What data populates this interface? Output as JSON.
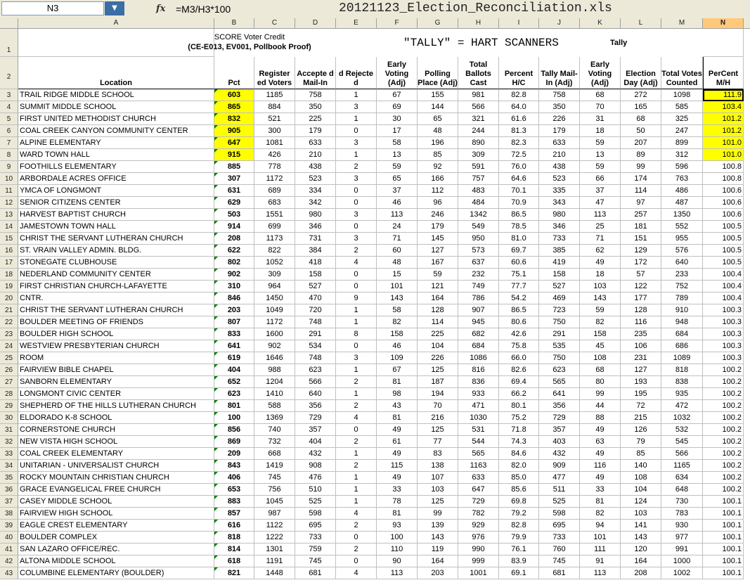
{
  "formula_bar": {
    "name_box": "N3",
    "dropdown_icon": "chevron-down-icon",
    "fx_label": "fx",
    "formula": "=M3/H3*100",
    "file_title": "20121123_Election_Reconciliation.xls"
  },
  "columns": [
    "A",
    "B",
    "C",
    "D",
    "E",
    "F",
    "G",
    "H",
    "I",
    "J",
    "K",
    "L",
    "M",
    "N"
  ],
  "title_row": {
    "row_number": "1",
    "score_line1": "SCORE Voter Credit",
    "score_line2": "(CE-E013, EV001, Pollbook Proof)",
    "tally_label": "\"TALLY\" = HART SCANNERS",
    "tally_small": "Tally"
  },
  "header_row": {
    "row_number": "2",
    "location": "Location",
    "pct": "Pct",
    "registered_voters": "Register ed Voters",
    "accepted_mail_in": "Accepte d Mail-In",
    "rejected": "d Rejecte d",
    "early_voting_adj": "Early Voting (Adj)",
    "polling_place_adj": "Polling Place (Adj)",
    "total_ballots_cast": "Total Ballots Cast",
    "percent_hc": "Percent H/C",
    "tally_mail_in_adj": "Tally Mail-In (Adj)",
    "early_voting_adj2": "Early Voting (Adj)",
    "election_day_adj": "Election Day (Adj)",
    "total_votes_counted": "Total Votes Counted",
    "percent_mh": "PerCent M/H"
  },
  "rows": [
    {
      "n": "3",
      "loc": "TRAIL RIDGE MIDDLE SCHOOL",
      "pct": "603",
      "c": "1185",
      "d": "758",
      "e": "1",
      "f": "67",
      "g": "155",
      "h": "981",
      "i": "82.8",
      "j": "758",
      "k": "68",
      "l": "272",
      "m": "1098",
      "nn": "111.9",
      "hl": true
    },
    {
      "n": "4",
      "loc": "SUMMIT MIDDLE SCHOOL",
      "pct": "865",
      "c": "884",
      "d": "350",
      "e": "3",
      "f": "69",
      "g": "144",
      "h": "566",
      "i": "64.0",
      "j": "350",
      "k": "70",
      "l": "165",
      "m": "585",
      "nn": "103.4",
      "hl": true
    },
    {
      "n": "5",
      "loc": "FIRST UNITED METHODIST CHURCH",
      "pct": "832",
      "c": "521",
      "d": "225",
      "e": "1",
      "f": "30",
      "g": "65",
      "h": "321",
      "i": "61.6",
      "j": "226",
      "k": "31",
      "l": "68",
      "m": "325",
      "nn": "101.2",
      "hl": true
    },
    {
      "n": "6",
      "loc": "COAL CREEK CANYON COMMUNITY CENTER",
      "pct": "905",
      "c": "300",
      "d": "179",
      "e": "0",
      "f": "17",
      "g": "48",
      "h": "244",
      "i": "81.3",
      "j": "179",
      "k": "18",
      "l": "50",
      "m": "247",
      "nn": "101.2",
      "hl": true
    },
    {
      "n": "7",
      "loc": "ALPINE ELEMENTARY",
      "pct": "647",
      "c": "1081",
      "d": "633",
      "e": "3",
      "f": "58",
      "g": "196",
      "h": "890",
      "i": "82.3",
      "j": "633",
      "k": "59",
      "l": "207",
      "m": "899",
      "nn": "101.0",
      "hl": true
    },
    {
      "n": "8",
      "loc": "WARD TOWN HALL",
      "pct": "915",
      "c": "426",
      "d": "210",
      "e": "1",
      "f": "13",
      "g": "85",
      "h": "309",
      "i": "72.5",
      "j": "210",
      "k": "13",
      "l": "89",
      "m": "312",
      "nn": "101.0",
      "hl": true
    },
    {
      "n": "9",
      "loc": "FOOTHILLS ELEMENTARY",
      "pct": "885",
      "c": "778",
      "d": "438",
      "e": "2",
      "f": "59",
      "g": "92",
      "h": "591",
      "i": "76.0",
      "j": "438",
      "k": "59",
      "l": "99",
      "m": "596",
      "nn": "100.8",
      "hl": false
    },
    {
      "n": "10",
      "loc": "ARBORDALE ACRES OFFICE",
      "pct": "307",
      "c": "1172",
      "d": "523",
      "e": "3",
      "f": "65",
      "g": "166",
      "h": "757",
      "i": "64.6",
      "j": "523",
      "k": "66",
      "l": "174",
      "m": "763",
      "nn": "100.8",
      "hl": false
    },
    {
      "n": "11",
      "loc": "YMCA OF LONGMONT",
      "pct": "631",
      "c": "689",
      "d": "334",
      "e": "0",
      "f": "37",
      "g": "112",
      "h": "483",
      "i": "70.1",
      "j": "335",
      "k": "37",
      "l": "114",
      "m": "486",
      "nn": "100.6",
      "hl": false
    },
    {
      "n": "12",
      "loc": "SENIOR CITIZENS CENTER",
      "pct": "629",
      "c": "683",
      "d": "342",
      "e": "0",
      "f": "46",
      "g": "96",
      "h": "484",
      "i": "70.9",
      "j": "343",
      "k": "47",
      "l": "97",
      "m": "487",
      "nn": "100.6",
      "hl": false
    },
    {
      "n": "13",
      "loc": "HARVEST BAPTIST CHURCH",
      "pct": "503",
      "c": "1551",
      "d": "980",
      "e": "3",
      "f": "113",
      "g": "246",
      "h": "1342",
      "i": "86.5",
      "j": "980",
      "k": "113",
      "l": "257",
      "m": "1350",
      "nn": "100.6",
      "hl": false
    },
    {
      "n": "14",
      "loc": "JAMESTOWN TOWN HALL",
      "pct": "914",
      "c": "699",
      "d": "346",
      "e": "0",
      "f": "24",
      "g": "179",
      "h": "549",
      "i": "78.5",
      "j": "346",
      "k": "25",
      "l": "181",
      "m": "552",
      "nn": "100.5",
      "hl": false
    },
    {
      "n": "15",
      "loc": "CHRIST THE SERVANT LUTHERAN CHURCH",
      "pct": "208",
      "c": "1173",
      "d": "731",
      "e": "3",
      "f": "71",
      "g": "145",
      "h": "950",
      "i": "81.0",
      "j": "733",
      "k": "71",
      "l": "151",
      "m": "955",
      "nn": "100.5",
      "hl": false
    },
    {
      "n": "16",
      "loc": "ST. VRAIN VALLEY ADMIN. BLDG.",
      "pct": "622",
      "c": "822",
      "d": "384",
      "e": "2",
      "f": "60",
      "g": "127",
      "h": "573",
      "i": "69.7",
      "j": "385",
      "k": "62",
      "l": "129",
      "m": "576",
      "nn": "100.5",
      "hl": false
    },
    {
      "n": "17",
      "loc": "STONEGATE CLUBHOUSE",
      "pct": "802",
      "c": "1052",
      "d": "418",
      "e": "4",
      "f": "48",
      "g": "167",
      "h": "637",
      "i": "60.6",
      "j": "419",
      "k": "49",
      "l": "172",
      "m": "640",
      "nn": "100.5",
      "hl": false
    },
    {
      "n": "18",
      "loc": "NEDERLAND COMMUNITY CENTER",
      "pct": "902",
      "c": "309",
      "d": "158",
      "e": "0",
      "f": "15",
      "g": "59",
      "h": "232",
      "i": "75.1",
      "j": "158",
      "k": "18",
      "l": "57",
      "m": "233",
      "nn": "100.4",
      "hl": false
    },
    {
      "n": "19",
      "loc": "FIRST CHRISTIAN CHURCH-LAFAYETTE",
      "pct": "310",
      "c": "964",
      "d": "527",
      "e": "0",
      "f": "101",
      "g": "121",
      "h": "749",
      "i": "77.7",
      "j": "527",
      "k": "103",
      "l": "122",
      "m": "752",
      "nn": "100.4",
      "hl": false
    },
    {
      "n": "20",
      "loc": "CNTR.",
      "pct": "846",
      "c": "1450",
      "d": "470",
      "e": "9",
      "f": "143",
      "g": "164",
      "h": "786",
      "i": "54.2",
      "j": "469",
      "k": "143",
      "l": "177",
      "m": "789",
      "nn": "100.4",
      "hl": false
    },
    {
      "n": "21",
      "loc": "CHRIST THE SERVANT LUTHERAN CHURCH",
      "pct": "203",
      "c": "1049",
      "d": "720",
      "e": "1",
      "f": "58",
      "g": "128",
      "h": "907",
      "i": "86.5",
      "j": "723",
      "k": "59",
      "l": "128",
      "m": "910",
      "nn": "100.3",
      "hl": false
    },
    {
      "n": "22",
      "loc": "BOULDER MEETING OF FRIENDS",
      "pct": "807",
      "c": "1172",
      "d": "748",
      "e": "1",
      "f": "82",
      "g": "114",
      "h": "945",
      "i": "80.6",
      "j": "750",
      "k": "82",
      "l": "116",
      "m": "948",
      "nn": "100.3",
      "hl": false
    },
    {
      "n": "23",
      "loc": "BOULDER HIGH SCHOOL",
      "pct": "833",
      "c": "1600",
      "d": "291",
      "e": "8",
      "f": "158",
      "g": "225",
      "h": "682",
      "i": "42.6",
      "j": "291",
      "k": "158",
      "l": "235",
      "m": "684",
      "nn": "100.3",
      "hl": false
    },
    {
      "n": "24",
      "loc": "WESTVIEW PRESBYTERIAN CHURCH",
      "pct": "641",
      "c": "902",
      "d": "534",
      "e": "0",
      "f": "46",
      "g": "104",
      "h": "684",
      "i": "75.8",
      "j": "535",
      "k": "45",
      "l": "106",
      "m": "686",
      "nn": "100.3",
      "hl": false
    },
    {
      "n": "25",
      "loc": "ROOM",
      "pct": "619",
      "c": "1646",
      "d": "748",
      "e": "3",
      "f": "109",
      "g": "226",
      "h": "1086",
      "i": "66.0",
      "j": "750",
      "k": "108",
      "l": "231",
      "m": "1089",
      "nn": "100.3",
      "hl": false
    },
    {
      "n": "26",
      "loc": "FAIRVIEW BIBLE CHAPEL",
      "pct": "404",
      "c": "988",
      "d": "623",
      "e": "1",
      "f": "67",
      "g": "125",
      "h": "816",
      "i": "82.6",
      "j": "623",
      "k": "68",
      "l": "127",
      "m": "818",
      "nn": "100.2",
      "hl": false
    },
    {
      "n": "27",
      "loc": "SANBORN ELEMENTARY",
      "pct": "652",
      "c": "1204",
      "d": "566",
      "e": "2",
      "f": "81",
      "g": "187",
      "h": "836",
      "i": "69.4",
      "j": "565",
      "k": "80",
      "l": "193",
      "m": "838",
      "nn": "100.2",
      "hl": false
    },
    {
      "n": "28",
      "loc": "LONGMONT CIVIC CENTER",
      "pct": "623",
      "c": "1410",
      "d": "640",
      "e": "1",
      "f": "98",
      "g": "194",
      "h": "933",
      "i": "66.2",
      "j": "641",
      "k": "99",
      "l": "195",
      "m": "935",
      "nn": "100.2",
      "hl": false
    },
    {
      "n": "29",
      "loc": "SHEPHERD OF THE HILLS LUTHERAN CHURCH",
      "pct": "801",
      "c": "588",
      "d": "356",
      "e": "2",
      "f": "43",
      "g": "70",
      "h": "471",
      "i": "80.1",
      "j": "356",
      "k": "44",
      "l": "72",
      "m": "472",
      "nn": "100.2",
      "hl": false
    },
    {
      "n": "30",
      "loc": "ELDORADO K-8 SCHOOL",
      "pct": "100",
      "c": "1369",
      "d": "729",
      "e": "4",
      "f": "81",
      "g": "216",
      "h": "1030",
      "i": "75.2",
      "j": "729",
      "k": "88",
      "l": "215",
      "m": "1032",
      "nn": "100.2",
      "hl": false
    },
    {
      "n": "31",
      "loc": "CORNERSTONE CHURCH",
      "pct": "856",
      "c": "740",
      "d": "357",
      "e": "0",
      "f": "49",
      "g": "125",
      "h": "531",
      "i": "71.8",
      "j": "357",
      "k": "49",
      "l": "126",
      "m": "532",
      "nn": "100.2",
      "hl": false
    },
    {
      "n": "32",
      "loc": "NEW VISTA HIGH SCHOOL",
      "pct": "869",
      "c": "732",
      "d": "404",
      "e": "2",
      "f": "61",
      "g": "77",
      "h": "544",
      "i": "74.3",
      "j": "403",
      "k": "63",
      "l": "79",
      "m": "545",
      "nn": "100.2",
      "hl": false
    },
    {
      "n": "33",
      "loc": "COAL CREEK ELEMENTARY",
      "pct": "209",
      "c": "668",
      "d": "432",
      "e": "1",
      "f": "49",
      "g": "83",
      "h": "565",
      "i": "84.6",
      "j": "432",
      "k": "49",
      "l": "85",
      "m": "566",
      "nn": "100.2",
      "hl": false
    },
    {
      "n": "34",
      "loc": "UNITARIAN - UNIVERSALIST CHURCH",
      "pct": "843",
      "c": "1419",
      "d": "908",
      "e": "2",
      "f": "115",
      "g": "138",
      "h": "1163",
      "i": "82.0",
      "j": "909",
      "k": "116",
      "l": "140",
      "m": "1165",
      "nn": "100.2",
      "hl": false
    },
    {
      "n": "35",
      "loc": "ROCKY MOUNTAIN CHRISTIAN CHURCH",
      "pct": "406",
      "c": "745",
      "d": "476",
      "e": "1",
      "f": "49",
      "g": "107",
      "h": "633",
      "i": "85.0",
      "j": "477",
      "k": "49",
      "l": "108",
      "m": "634",
      "nn": "100.2",
      "hl": false
    },
    {
      "n": "36",
      "loc": "GRACE EVANGELICAL FREE CHURCH",
      "pct": "653",
      "c": "756",
      "d": "510",
      "e": "1",
      "f": "33",
      "g": "103",
      "h": "647",
      "i": "85.6",
      "j": "511",
      "k": "33",
      "l": "104",
      "m": "648",
      "nn": "100.2",
      "hl": false
    },
    {
      "n": "37",
      "loc": "CASEY MIDDLE SCHOOL",
      "pct": "883",
      "c": "1045",
      "d": "525",
      "e": "1",
      "f": "78",
      "g": "125",
      "h": "729",
      "i": "69.8",
      "j": "525",
      "k": "81",
      "l": "124",
      "m": "730",
      "nn": "100.1",
      "hl": false
    },
    {
      "n": "38",
      "loc": "FAIRVIEW HIGH SCHOOL",
      "pct": "857",
      "c": "987",
      "d": "598",
      "e": "4",
      "f": "81",
      "g": "99",
      "h": "782",
      "i": "79.2",
      "j": "598",
      "k": "82",
      "l": "103",
      "m": "783",
      "nn": "100.1",
      "hl": false
    },
    {
      "n": "39",
      "loc": "EAGLE CREST ELEMENTARY",
      "pct": "616",
      "c": "1122",
      "d": "695",
      "e": "2",
      "f": "93",
      "g": "139",
      "h": "929",
      "i": "82.8",
      "j": "695",
      "k": "94",
      "l": "141",
      "m": "930",
      "nn": "100.1",
      "hl": false
    },
    {
      "n": "40",
      "loc": "BOULDER COMPLEX",
      "pct": "818",
      "c": "1222",
      "d": "733",
      "e": "0",
      "f": "100",
      "g": "143",
      "h": "976",
      "i": "79.9",
      "j": "733",
      "k": "101",
      "l": "143",
      "m": "977",
      "nn": "100.1",
      "hl": false
    },
    {
      "n": "41",
      "loc": "SAN LAZARO OFFICE/REC.",
      "pct": "814",
      "c": "1301",
      "d": "759",
      "e": "2",
      "f": "110",
      "g": "119",
      "h": "990",
      "i": "76.1",
      "j": "760",
      "k": "111",
      "l": "120",
      "m": "991",
      "nn": "100.1",
      "hl": false
    },
    {
      "n": "42",
      "loc": "ALTONA MIDDLE SCHOOL",
      "pct": "618",
      "c": "1191",
      "d": "745",
      "e": "0",
      "f": "90",
      "g": "164",
      "h": "999",
      "i": "83.9",
      "j": "745",
      "k": "91",
      "l": "164",
      "m": "1000",
      "nn": "100.1",
      "hl": false
    },
    {
      "n": "43",
      "loc": "COLUMBINE ELEMENTARY (BOULDER)",
      "pct": "821",
      "c": "1448",
      "d": "681",
      "e": "4",
      "f": "113",
      "g": "203",
      "h": "1001",
      "i": "69.1",
      "j": "681",
      "k": "113",
      "l": "208",
      "m": "1002",
      "nn": "100.1",
      "hl": false
    }
  ]
}
